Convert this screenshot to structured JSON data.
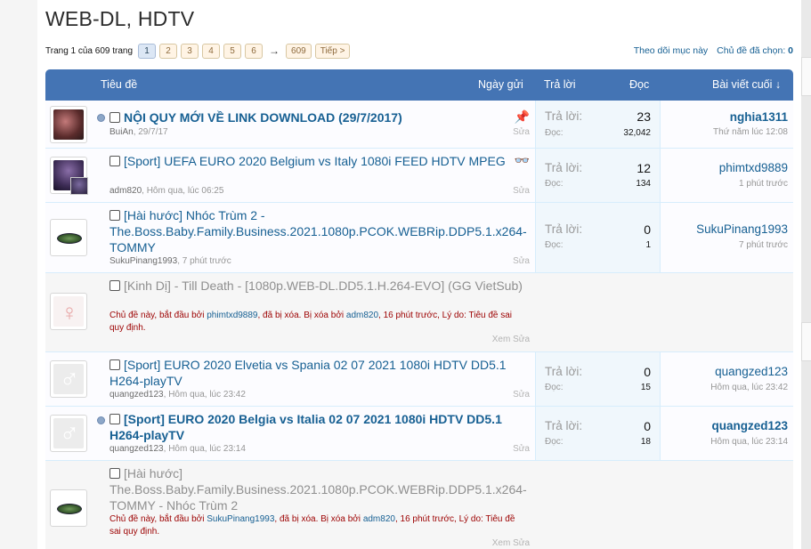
{
  "forum_title": "WEB-DL, HDTV",
  "pagination": {
    "label": "Trang 1 của 609 trang",
    "pages": [
      "1",
      "2",
      "3",
      "4",
      "5",
      "6"
    ],
    "arrow": "→",
    "last_page": "609",
    "next": "Tiếp >"
  },
  "toplinks": {
    "watch": "Theo dõi mục này",
    "selected_label": "Chủ đề đã chọn:",
    "selected_count": "0"
  },
  "headers": {
    "title": "Tiêu đề",
    "date": "Ngày gửi",
    "replies": "Trả lời",
    "views": "Đọc",
    "last_post": "Bài viết cuối ↓"
  },
  "stat_labels": {
    "replies": "Trả lời:",
    "views": "Đọc:"
  },
  "threads": [
    {
      "title": "NỘI QUY MỚI VỀ LINK DOWNLOAD (29/7/2017)",
      "author": "BuiAn",
      "date": "29/7/17",
      "edit": "Sửa",
      "replies": "23",
      "views": "32,042",
      "last_user": "nghia1311",
      "last_time": "Thứ năm lúc 12:08"
    },
    {
      "title": "[Sport] UEFA EURO 2020 Belgium vs Italy 1080i FEED HDTV MPEG",
      "author": "adm820",
      "date": "Hôm qua, lúc 06:25",
      "edit": "Sửa",
      "replies": "12",
      "views": "134",
      "last_user": "phimtxd9889",
      "last_time": "1 phút trước"
    },
    {
      "title": "[Hài hước] Nhóc Trùm 2 - The.Boss.Baby.Family.Business.2021.1080p.PCOK.WEBRip.DDP5.1.x264-TOMMY",
      "author": "SukuPinang1993",
      "date": "7 phút trước",
      "edit": "Sửa",
      "replies": "0",
      "views": "1",
      "last_user": "SukuPinang1993",
      "last_time": "7 phút trước"
    },
    {
      "title": "[Kinh Dị] - Till Death - [1080p.WEB-DL.DD5.1.H.264-EVO] (GG VietSub)",
      "deleted": {
        "p1": "Chủ đề này, bắt đầu bởi ",
        "starter": "phimtxd9889",
        "p2": ", đã bị xóa. Bị xóa bởi ",
        "deleter": "adm820",
        "p3": ", 16 phút trước, Lý do: Tiêu đề sai quy định."
      },
      "actions": "Xem Sửa"
    },
    {
      "title": "[Sport] EURO 2020 Elvetia vs Spania 02 07 2021 1080i HDTV DD5.1 H264-playTV",
      "author": "quangzed123",
      "date": "Hôm qua, lúc 23:42",
      "edit": "Sửa",
      "replies": "0",
      "views": "15",
      "last_user": "quangzed123",
      "last_time": "Hôm qua, lúc 23:42"
    },
    {
      "title": "[Sport] EURO 2020 Belgia vs Italia 02 07 2021 1080i HDTV DD5.1 H264-playTV",
      "author": "quangzed123",
      "date": "Hôm qua, lúc 23:14",
      "edit": "Sửa",
      "replies": "0",
      "views": "18",
      "last_user": "quangzed123",
      "last_time": "Hôm qua, lúc 23:14"
    },
    {
      "title": "[Hài hước] The.Boss.Baby.Family.Business.2021.1080p.PCOK.WEBRip.DDP5.1.x264-TOMMY - Nhóc Trùm 2",
      "deleted": {
        "p1": "Chủ đề này, bắt đầu bởi ",
        "starter": "SukuPinang1993",
        "p2": ", đã bị xóa. Bị xóa bởi ",
        "deleter": "adm820",
        "p3": ", 16 phút trước, Lý do: Tiêu đề sai quy định."
      },
      "actions": "Xem Sửa"
    }
  ]
}
